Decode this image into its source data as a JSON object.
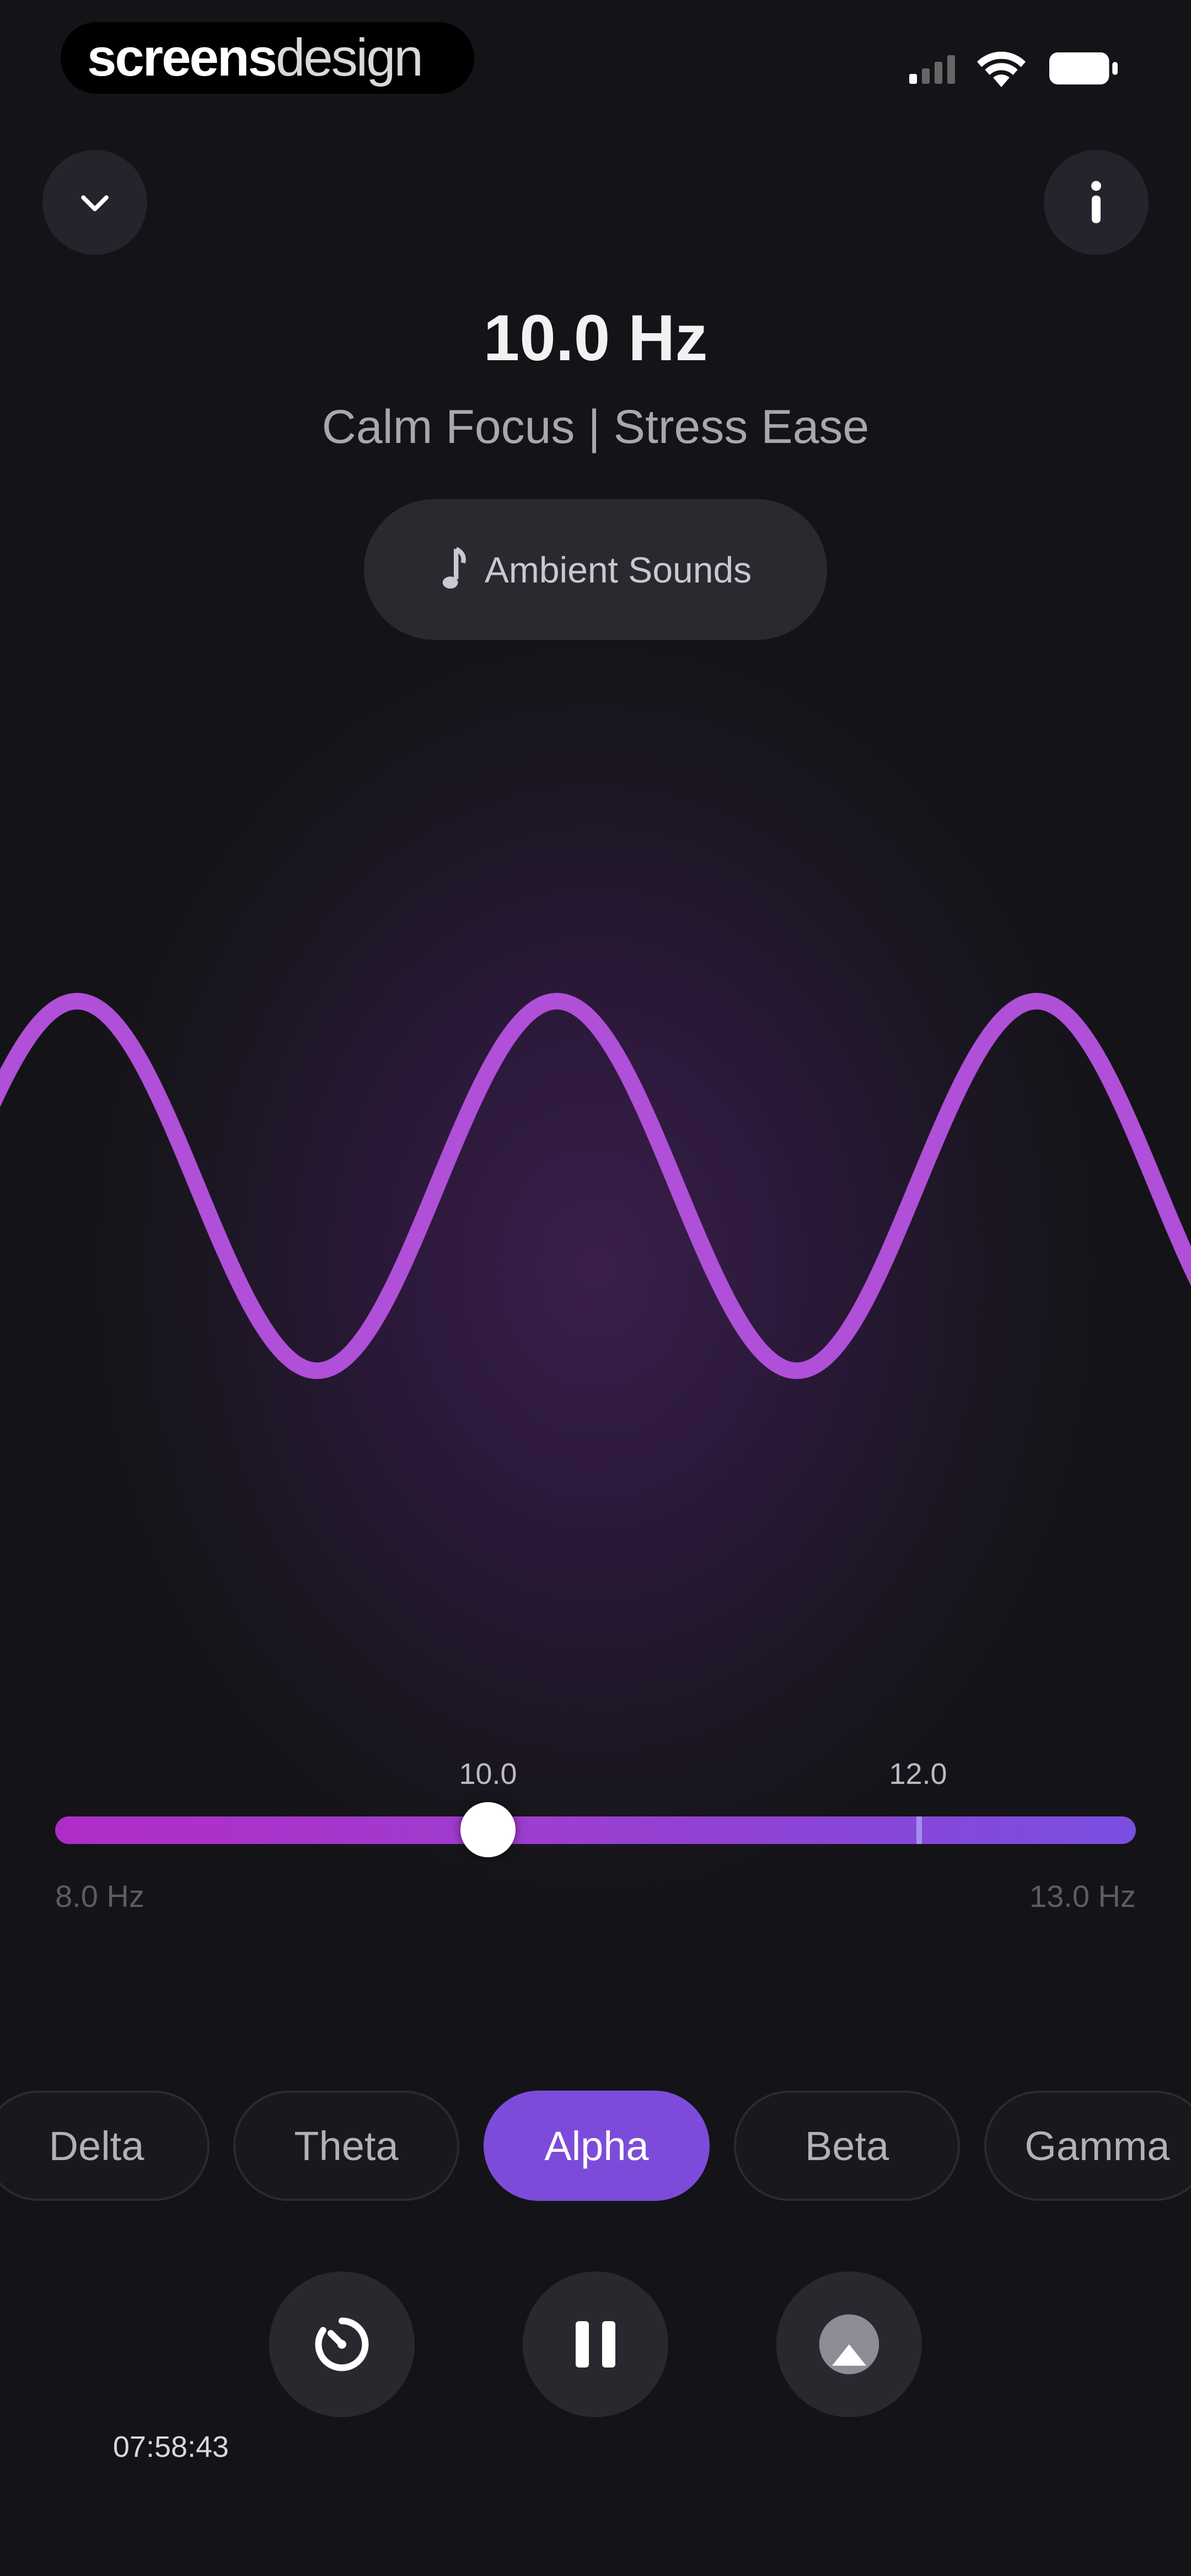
{
  "status_bar": {
    "watermark_bold": "screens",
    "watermark_light": "design",
    "icons": [
      "cellular-signal-icon",
      "wifi-icon",
      "battery-icon"
    ]
  },
  "header": {
    "collapse_icon": "chevron-down-icon",
    "info_icon": "info-icon",
    "frequency": "10.0 Hz",
    "subtitle": "Calm Focus | Stress Ease",
    "ambient_label": "Ambient Sounds",
    "ambient_icon": "music-note-icon"
  },
  "wave": {
    "color": "#b04fd8",
    "cycles_visible": 2.5
  },
  "slider": {
    "current_label": "10.0",
    "marker_label": "12.0",
    "min_label": "8.0 Hz",
    "max_label": "13.0 Hz",
    "min": 8.0,
    "max": 13.0,
    "value": 10.0,
    "marker": 12.0
  },
  "bands": [
    {
      "label": "Delta",
      "active": false
    },
    {
      "label": "Theta",
      "active": false
    },
    {
      "label": "Alpha",
      "active": true
    },
    {
      "label": "Beta",
      "active": false
    },
    {
      "label": "Gamma",
      "active": false
    }
  ],
  "controls": {
    "timer_icon": "timer-icon",
    "timer_text": "07:58:43",
    "pause_icon": "pause-icon",
    "airplay_icon": "airplay-icon"
  },
  "colors": {
    "accent": "#7d4bd9",
    "background": "#141317",
    "wave": "#b04fd8"
  }
}
